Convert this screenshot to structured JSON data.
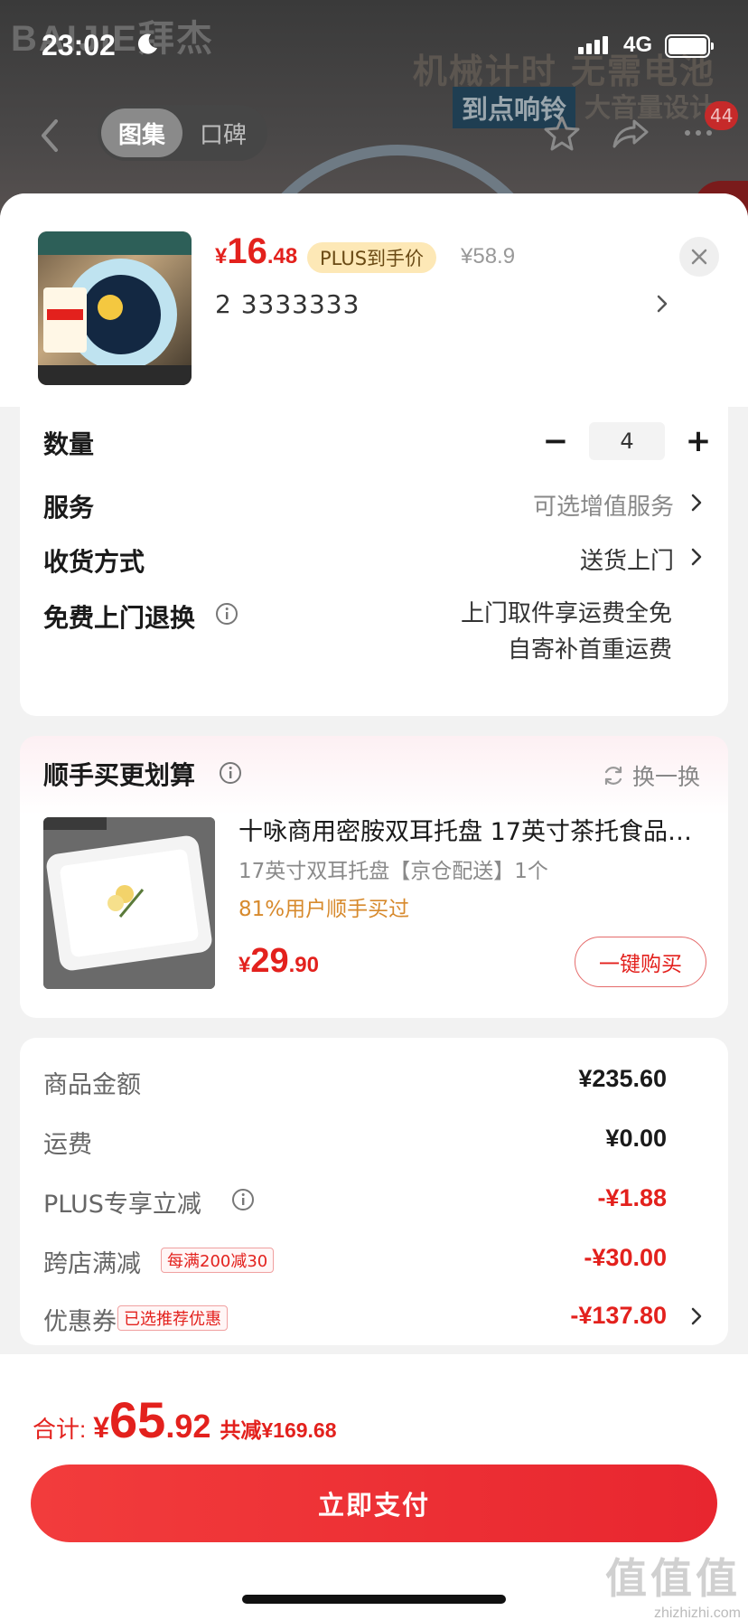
{
  "status_bar": {
    "time": "23:02",
    "network": "4G"
  },
  "background": {
    "brand": "BAIJIE拜杰",
    "headline": "机械计时 无需电池",
    "tag_highlight": "到点响铃",
    "tag_plain": "大音量设计"
  },
  "nav": {
    "tabs": [
      {
        "label": "图集",
        "active": true
      },
      {
        "label": "口碑",
        "active": false
      }
    ],
    "more_badge": "44"
  },
  "product": {
    "price_currency": "¥",
    "price_int": "16",
    "price_dec": ".48",
    "plus_tag": "PLUS到手价",
    "original_price": "¥58.9",
    "spec": "2  3333333"
  },
  "options": {
    "quantity_label": "数量",
    "quantity_minus": "−",
    "quantity_value": "4",
    "quantity_plus": "+",
    "service_label": "服务",
    "service_value": "可选增值服务",
    "delivery_label": "收货方式",
    "delivery_value": "送货上门",
    "return_label": "免费上门退换",
    "return_line1": "上门取件享运费全免",
    "return_line2": "自寄补首重运费"
  },
  "recommend": {
    "title": "顺手买更划算",
    "swap_label": "换一换",
    "item_name": "十咏商用密胺双耳托盘 17英寸茶托食品餐盘",
    "item_spec": "17英寸双耳托盘【京仓配送】1个",
    "item_rate": "81%用户顺手买过",
    "price_currency": "¥",
    "price_int": "29",
    "price_dec": ".90",
    "buy_label": "一键购买"
  },
  "summary": {
    "rows": [
      {
        "label": "商品金额",
        "value": "¥235.60",
        "red": false
      },
      {
        "label": "运费",
        "value": "¥0.00",
        "red": false
      },
      {
        "label": "PLUS专享立减",
        "value": "-¥1.88",
        "red": true
      },
      {
        "label": "跨店满减",
        "value": "-¥30.00",
        "red": true,
        "tag": "每满200减30"
      },
      {
        "label": "优惠券",
        "value": "-¥137.80",
        "red": true,
        "tag": "已选推荐优惠"
      }
    ]
  },
  "footer": {
    "total_label": "合计:",
    "total_currency": "¥",
    "total_int": "65",
    "total_dec": ".92",
    "saved": "共减¥169.68",
    "pay_label": "立即支付"
  },
  "watermark": {
    "line1": "值值值",
    "line2": "zhizhizhi.com"
  },
  "colors": {
    "accent_red": "#e3211d",
    "plus_tag_bg": "#fde8b6"
  }
}
